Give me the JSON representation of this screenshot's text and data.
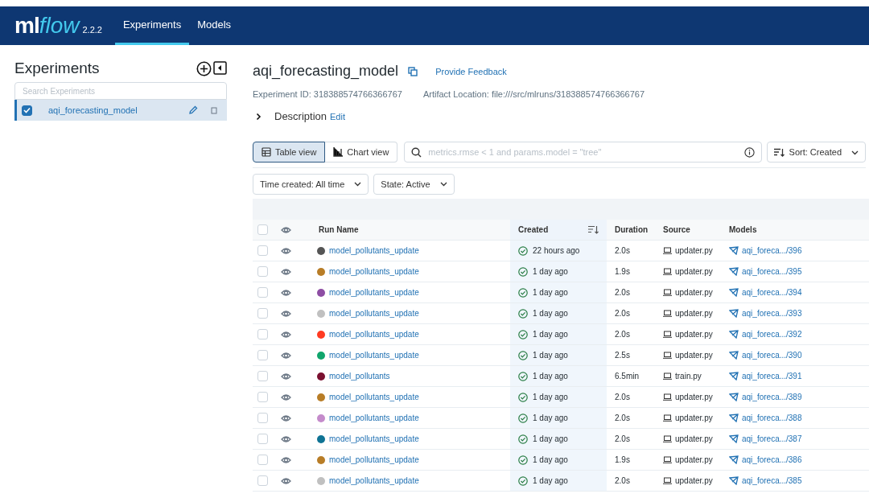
{
  "nav": {
    "logo": {
      "ml": "ml",
      "flow": "flow",
      "version": "2.2.2"
    },
    "tabs": [
      {
        "label": "Experiments",
        "selected": true
      },
      {
        "label": "Models",
        "selected": false
      }
    ]
  },
  "sidebar": {
    "title": "Experiments",
    "search": {
      "placeholder": "Search Experiments"
    },
    "experiments": [
      {
        "name": "aqi_forecasting_model",
        "selected": true
      }
    ]
  },
  "experiment": {
    "title": "aqi_forecasting_model",
    "feedback_link": "Provide Feedback",
    "experiment_id": "Experiment ID: 318388574766366767",
    "artifact_location": "Artifact Location: file:///src/mlruns/318388574766366767",
    "description": "Description",
    "edit_link": "Edit"
  },
  "views": [
    {
      "label": "Table view",
      "kind": "table",
      "selected": true
    },
    {
      "label": "Chart view",
      "kind": "chart",
      "selected": false
    }
  ],
  "search": {
    "placeholder": "metrics.rmse < 1 and params.model = \"tree\""
  },
  "sort": "Sort: Created",
  "filters": [
    "Time created: All time",
    "State: Active"
  ],
  "table": {
    "all_checked": false,
    "columns": [
      "Run Name",
      "Created",
      "Duration",
      "Source",
      "Models"
    ],
    "rows": [
      {
        "checked": false,
        "color": "#555555",
        "name": "model_pollutants_update",
        "created": "22 hours ago",
        "duration": "2.0s",
        "source": "updater.py",
        "model": "aqi_foreca.../396"
      },
      {
        "checked": false,
        "color": "#b87d27",
        "name": "model_pollutants_update",
        "created": "1 day ago",
        "duration": "1.9s",
        "source": "updater.py",
        "model": "aqi_foreca.../395"
      },
      {
        "checked": false,
        "color": "#8e4ea4",
        "name": "model_pollutants_update",
        "created": "1 day ago",
        "duration": "2.0s",
        "source": "updater.py",
        "model": "aqi_foreca.../394"
      },
      {
        "checked": false,
        "color": "#c0c0c0",
        "name": "model_pollutants_update",
        "created": "1 day ago",
        "duration": "2.0s",
        "source": "updater.py",
        "model": "aqi_foreca.../393"
      },
      {
        "checked": false,
        "color": "#ff3b22",
        "name": "model_pollutants_update",
        "created": "1 day ago",
        "duration": "2.0s",
        "source": "updater.py",
        "model": "aqi_foreca.../392"
      },
      {
        "checked": false,
        "color": "#10a56c",
        "name": "model_pollutants_update",
        "created": "1 day ago",
        "duration": "2.5s",
        "source": "updater.py",
        "model": "aqi_foreca.../390"
      },
      {
        "checked": false,
        "color": "#7a1030",
        "name": "model_pollutants",
        "created": "1 day ago",
        "duration": "6.5min",
        "source": "train.py",
        "model": "aqi_foreca.../391"
      },
      {
        "checked": false,
        "color": "#b87d27",
        "name": "model_pollutants_update",
        "created": "1 day ago",
        "duration": "2.0s",
        "source": "updater.py",
        "model": "aqi_foreca.../389"
      },
      {
        "checked": false,
        "color": "#c48bcb",
        "name": "model_pollutants_update",
        "created": "1 day ago",
        "duration": "2.0s",
        "source": "updater.py",
        "model": "aqi_foreca.../388"
      },
      {
        "checked": false,
        "color": "#0f7394",
        "name": "model_pollutants_update",
        "created": "1 day ago",
        "duration": "2.0s",
        "source": "updater.py",
        "model": "aqi_foreca.../387"
      },
      {
        "checked": false,
        "color": "#b87d27",
        "name": "model_pollutants_update",
        "created": "1 day ago",
        "duration": "1.9s",
        "source": "updater.py",
        "model": "aqi_foreca.../386"
      },
      {
        "checked": false,
        "color": "#c0c0c0",
        "name": "model_pollutants_update",
        "created": "1 day ago",
        "duration": "2.0s",
        "source": "updater.py",
        "model": "aqi_foreca.../385"
      }
    ]
  }
}
